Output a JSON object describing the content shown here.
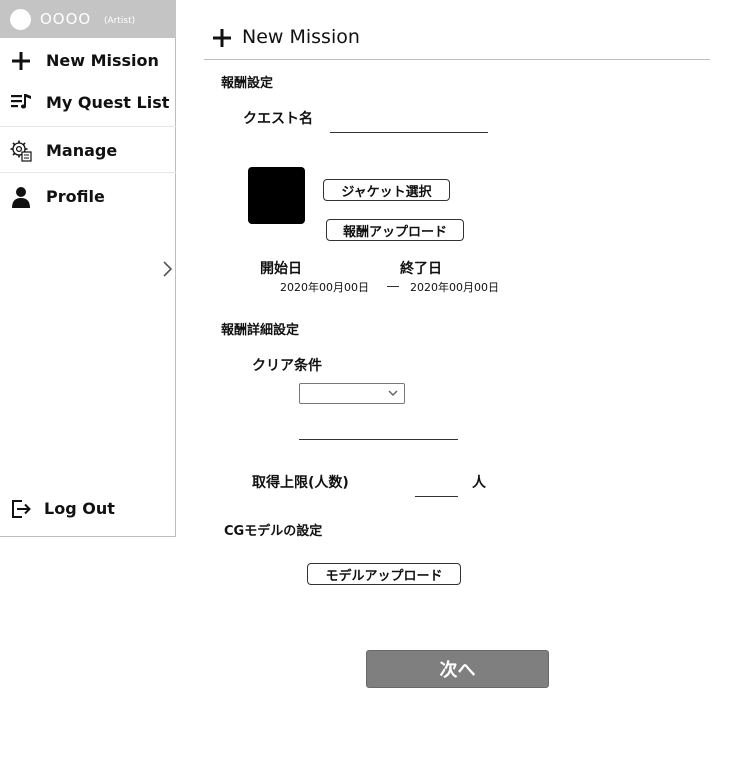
{
  "user": {
    "name": "OOOO",
    "role": "(Artist)"
  },
  "sidebar": {
    "items": [
      {
        "label": "New Mission",
        "icon": "plus-icon"
      },
      {
        "label": "My Quest List",
        "icon": "music-list-icon"
      },
      {
        "label": "Manage",
        "icon": "settings-gear-icon"
      },
      {
        "label": "Profile",
        "icon": "person-icon"
      }
    ],
    "logout_label": "Log Out"
  },
  "header": {
    "title": "New Mission"
  },
  "reward_settings": {
    "section_title": "報酬設定",
    "quest_name_label": "クエスト名",
    "quest_name_value": "",
    "jacket_select_button": "ジャケット選択",
    "reward_upload_button": "報酬アップロード",
    "start_date_label": "開始日",
    "end_date_label": "終了日",
    "start_date_value": "2020年00月00日",
    "end_date_value": "2020年00月00日"
  },
  "reward_detail_settings": {
    "section_title": "報酬詳細設定",
    "clear_condition_label": "クリア条件",
    "clear_condition_selected": "",
    "clear_condition_text": "",
    "acquisition_limit_label": "取得上限(人数)",
    "acquisition_limit_value": "",
    "acquisition_limit_unit": "人"
  },
  "cg_model_settings": {
    "section_title": "CGモデルの設定",
    "model_upload_button": "モデルアップロード"
  },
  "next_button": "次へ",
  "colors": {
    "user_bar_bg": "#c4c4c4",
    "jacket_thumb": "#000000",
    "next_button_bg": "#7f7f7f"
  }
}
